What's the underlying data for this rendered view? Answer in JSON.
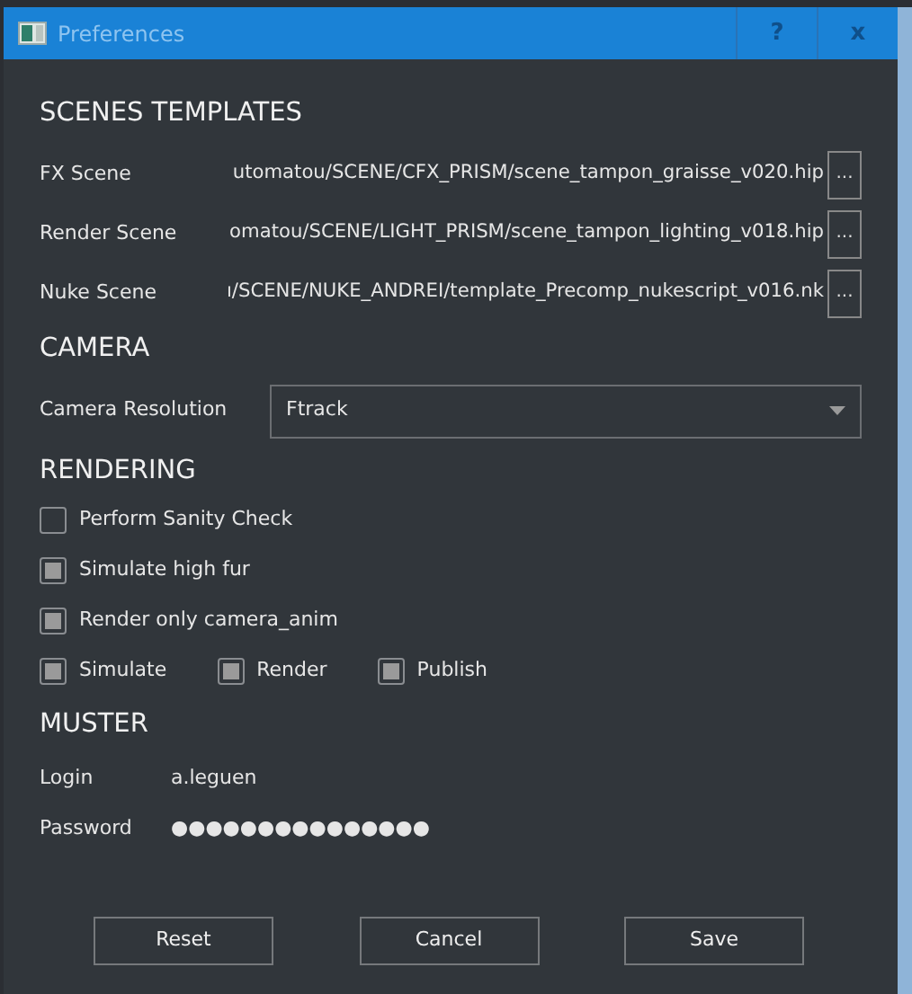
{
  "window": {
    "title": "Preferences",
    "buttons": [
      "?",
      "x"
    ]
  },
  "scenes_templates": {
    "heading": "SCENES TEMPLATES",
    "rows": [
      {
        "label": "FX Scene",
        "value": "utomatou/SCENE/CFX_PRISM/scene_tampon_graisse_v020.hip",
        "browse": "..."
      },
      {
        "label": "Render Scene",
        "value": "omatou/SCENE/LIGHT_PRISM/scene_tampon_lighting_v018.hip",
        "browse": "..."
      },
      {
        "label": "Nuke Scene",
        "value": "ı/SCENE/NUKE_ANDREI/template_Precomp_nukescript_v016.nk",
        "browse": "..."
      }
    ]
  },
  "camera": {
    "heading": "CAMERA",
    "label": "Camera Resolution",
    "value": "Ftrack"
  },
  "rendering": {
    "heading": "RENDERING",
    "rows": [
      [
        {
          "label": "Perform Sanity Check",
          "checked": false
        }
      ],
      [
        {
          "label": "Simulate high fur",
          "checked": true
        }
      ],
      [
        {
          "label": "Render only camera_anim",
          "checked": true
        }
      ],
      [
        {
          "label": "Simulate",
          "checked": true
        },
        {
          "label": "Render",
          "checked": true
        },
        {
          "label": "Publish",
          "checked": true
        }
      ]
    ]
  },
  "muster": {
    "heading": "MUSTER",
    "login_label": "Login",
    "login": "a.leguen",
    "password_label": "Password",
    "password": "●●●●●●●●●●●●●●●"
  },
  "buttons": [
    "Reset",
    "Cancel",
    "Save"
  ]
}
